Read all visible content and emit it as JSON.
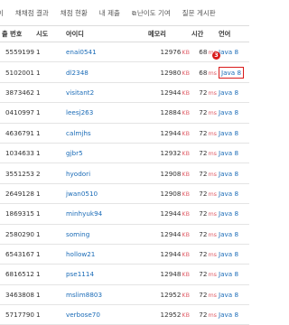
{
  "tabs": [
    {
      "label": "이"
    },
    {
      "label": "채채점 결과"
    },
    {
      "label": "채점 현황"
    },
    {
      "label": "내 제출"
    },
    {
      "label": "난이도 기여"
    },
    {
      "label": "질문 게시판"
    }
  ],
  "table": {
    "headers": [
      "출 번호",
      "시도",
      "아이디",
      "메모리",
      "시간",
      "언어"
    ],
    "rows": [
      {
        "id": "5559199",
        "attempt": "1",
        "user": "enai0541",
        "memory": "12976",
        "memory_unit": "KB",
        "time": "68",
        "time_unit": "ms",
        "lang": "Java 8"
      },
      {
        "id": "5102001",
        "attempt": "1",
        "user": "dl2348",
        "memory": "12980",
        "memory_unit": "KB",
        "time": "68",
        "time_unit": "ms",
        "lang": "Java 8"
      },
      {
        "id": "3873462",
        "attempt": "1",
        "user": "visitant2",
        "memory": "12944",
        "memory_unit": "KB",
        "time": "72",
        "time_unit": "ms",
        "lang": "Java 8"
      },
      {
        "id": "0410997",
        "attempt": "1",
        "user": "leesj263",
        "memory": "12884",
        "memory_unit": "KB",
        "time": "72",
        "time_unit": "ms",
        "lang": "Java 8"
      },
      {
        "id": "4636791",
        "attempt": "1",
        "user": "calmjhs",
        "memory": "12944",
        "memory_unit": "KB",
        "time": "72",
        "time_unit": "ms",
        "lang": "Java 8"
      },
      {
        "id": "1034633",
        "attempt": "1",
        "user": "gjbr5",
        "memory": "12932",
        "memory_unit": "KB",
        "time": "72",
        "time_unit": "ms",
        "lang": "Java 8"
      },
      {
        "id": "3551253",
        "attempt": "2",
        "user": "hyodori",
        "memory": "12908",
        "memory_unit": "KB",
        "time": "72",
        "time_unit": "ms",
        "lang": "Java 8"
      },
      {
        "id": "2649128",
        "attempt": "1",
        "user": "jwan0510",
        "memory": "12908",
        "memory_unit": "KB",
        "time": "72",
        "time_unit": "ms",
        "lang": "Java 8"
      },
      {
        "id": "1869315",
        "attempt": "1",
        "user": "minhyuk94",
        "memory": "12944",
        "memory_unit": "KB",
        "time": "72",
        "time_unit": "ms",
        "lang": "Java 8"
      },
      {
        "id": "2580290",
        "attempt": "1",
        "user": "soming",
        "memory": "12944",
        "memory_unit": "KB",
        "time": "72",
        "time_unit": "ms",
        "lang": "Java 8"
      },
      {
        "id": "6543167",
        "attempt": "1",
        "user": "hollow21",
        "memory": "12944",
        "memory_unit": "KB",
        "time": "72",
        "time_unit": "ms",
        "lang": "Java 8"
      },
      {
        "id": "6816512",
        "attempt": "1",
        "user": "pse1114",
        "memory": "12948",
        "memory_unit": "KB",
        "time": "72",
        "time_unit": "ms",
        "lang": "Java 8"
      },
      {
        "id": "3463808",
        "attempt": "1",
        "user": "mslim8803",
        "memory": "12952",
        "memory_unit": "KB",
        "time": "72",
        "time_unit": "ms",
        "lang": "Java 8"
      },
      {
        "id": "5717790",
        "attempt": "1",
        "user": "verbose70",
        "memory": "12952",
        "memory_unit": "KB",
        "time": "72",
        "time_unit": "ms",
        "lang": "Java 8"
      }
    ]
  },
  "annotation": {
    "marker": "3"
  },
  "icons": {
    "external_link": "external-link-icon"
  },
  "colors": {
    "link": "#1a6bb7",
    "unit": "#e0606a",
    "highlight": "#d91a1a"
  }
}
